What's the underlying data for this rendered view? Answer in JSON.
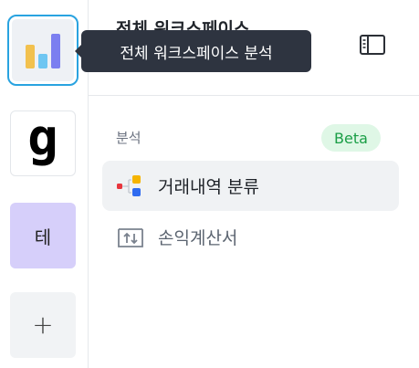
{
  "workspace_rail": {
    "items": [
      {
        "label": "",
        "icon": "bar-chart-icon"
      },
      {
        "label": "g",
        "icon": "g-logo-icon"
      },
      {
        "label": "테"
      },
      {
        "label": "+",
        "icon": "plus-icon"
      }
    ]
  },
  "header": {
    "title": "전체 워크스페이스",
    "toggle_icon": "sidebar-toggle-icon"
  },
  "tooltip": {
    "text": "전체 워크스페이스 분석"
  },
  "section": {
    "label": "분석",
    "badge": "Beta"
  },
  "nav": {
    "items": [
      {
        "label": "거래내역 분류",
        "icon": "flow-category-icon",
        "active": true
      },
      {
        "label": "손익계산서",
        "icon": "income-statement-icon",
        "active": false
      }
    ]
  },
  "colors": {
    "accent_border": "#29a3e0",
    "tooltip_bg": "#2e3440",
    "beta_bg": "#dff7e6",
    "beta_text": "#1a9e46",
    "workspace_te_bg": "#d6cffa"
  }
}
